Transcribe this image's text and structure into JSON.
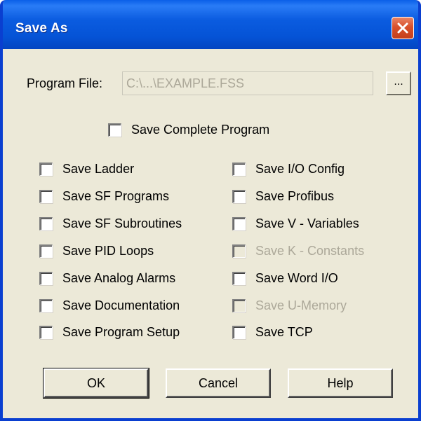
{
  "window": {
    "title": "Save As",
    "close_icon": "close-icon"
  },
  "program_file": {
    "label": "Program File:",
    "value": "C:\\...\\EXAMPLE.FSS",
    "browse_label": "..."
  },
  "save_complete": {
    "label": "Save Complete Program",
    "checked": false
  },
  "left_options": [
    {
      "label": "Save Ladder",
      "checked": false,
      "enabled": true
    },
    {
      "label": "Save SF Programs",
      "checked": false,
      "enabled": true
    },
    {
      "label": "Save SF Subroutines",
      "checked": false,
      "enabled": true
    },
    {
      "label": "Save PID Loops",
      "checked": false,
      "enabled": true
    },
    {
      "label": "Save Analog Alarms",
      "checked": false,
      "enabled": true
    },
    {
      "label": "Save Documentation",
      "checked": false,
      "enabled": true
    },
    {
      "label": "Save Program Setup",
      "checked": false,
      "enabled": true
    }
  ],
  "right_options": [
    {
      "label": "Save I/O Config",
      "checked": false,
      "enabled": true
    },
    {
      "label": "Save Profibus",
      "checked": false,
      "enabled": true
    },
    {
      "label": "Save V - Variables",
      "checked": false,
      "enabled": true
    },
    {
      "label": "Save K - Constants",
      "checked": false,
      "enabled": false
    },
    {
      "label": "Save Word I/O",
      "checked": false,
      "enabled": true
    },
    {
      "label": "Save U-Memory",
      "checked": false,
      "enabled": false
    },
    {
      "label": "Save TCP",
      "checked": false,
      "enabled": true
    }
  ],
  "buttons": {
    "ok": "OK",
    "cancel": "Cancel",
    "help": "Help"
  },
  "colors": {
    "titlebar": "#0553d6",
    "dialog_bg": "#ece9d8",
    "disabled_text": "#aca899",
    "close_button": "#d8502b"
  }
}
